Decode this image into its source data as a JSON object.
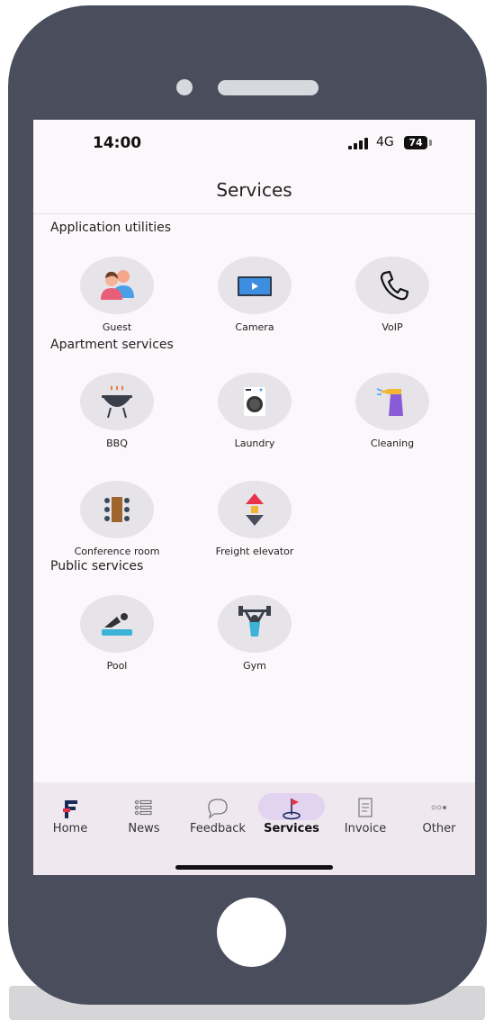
{
  "status_bar": {
    "time": "14:00",
    "network": "4G",
    "battery": "74"
  },
  "header": {
    "title": "Services"
  },
  "sections": [
    {
      "title": "Application utilities",
      "items": [
        {
          "label": "Guest",
          "icon": "guest-icon"
        },
        {
          "label": "Camera",
          "icon": "camera-icon"
        },
        {
          "label": "VoIP",
          "icon": "phone-icon"
        }
      ]
    },
    {
      "title": "Apartment services",
      "items": [
        {
          "label": "BBQ",
          "icon": "bbq-grill-icon"
        },
        {
          "label": "Laundry",
          "icon": "washing-machine-icon"
        },
        {
          "label": "Cleaning",
          "icon": "spray-bottle-icon"
        },
        {
          "label": "Conference room",
          "icon": "conference-room-icon"
        },
        {
          "label": "Freight elevator",
          "icon": "elevator-icon"
        }
      ]
    },
    {
      "title": "Public services",
      "items": [
        {
          "label": "Pool",
          "icon": "swimmer-icon"
        },
        {
          "label": "Gym",
          "icon": "weightlifter-icon"
        }
      ]
    }
  ],
  "tabbar": {
    "active": "Services",
    "items": [
      {
        "label": "Home",
        "icon": "app-logo-icon"
      },
      {
        "label": "News",
        "icon": "list-icon"
      },
      {
        "label": "Feedback",
        "icon": "chat-bubble-icon"
      },
      {
        "label": "Services",
        "icon": "golf-flag-icon"
      },
      {
        "label": "Invoice",
        "icon": "invoice-icon"
      },
      {
        "label": "Other",
        "icon": "more-dots-icon"
      }
    ]
  },
  "colors": {
    "phone_frame": "#4a4d5c",
    "screen_bg": "#fbf7fa",
    "tab_bar_bg": "#efe9ef",
    "active_pill": "#e2d3f0",
    "icon_circle": "#e6e3e9",
    "accent_red": "#e8324a"
  }
}
